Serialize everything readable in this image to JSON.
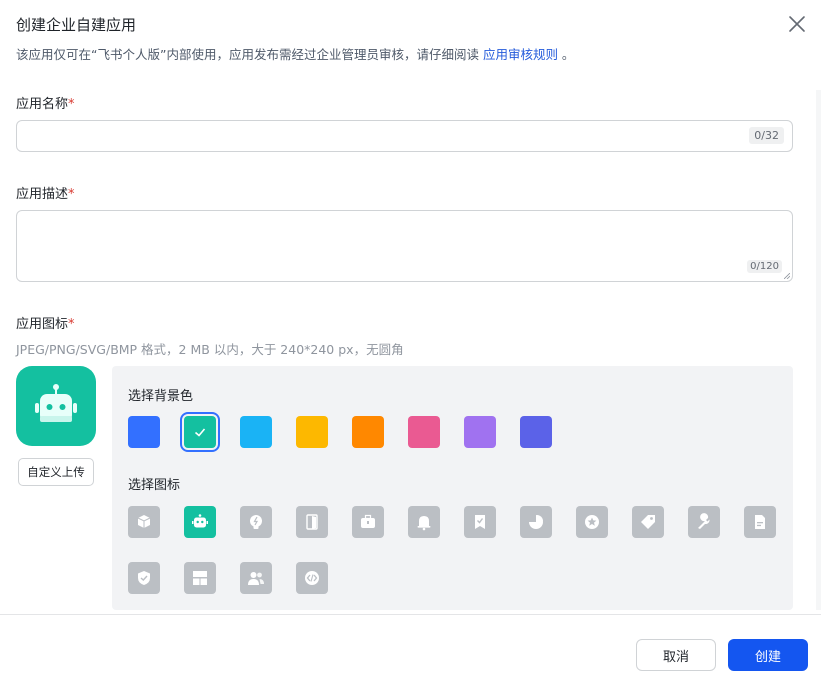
{
  "dialog": {
    "title": "创建企业自建应用",
    "notice_text": "该应用仅可在“飞书个人版”内部使用，应用发布需经过企业管理员审核，请仔细阅读 ",
    "notice_link": "应用审核规则",
    "notice_suffix": " 。"
  },
  "form": {
    "name_label": "应用名称",
    "name_value": "",
    "name_counter": "0/32",
    "desc_label": "应用描述",
    "desc_value": "",
    "desc_counter": "0/120",
    "required_mark": "*",
    "icon_label": "应用图标",
    "icon_hint": "JPEG/PNG/SVG/BMP 格式，2 MB 以内，大于 240*240 px，无圆角",
    "upload_label": "自定义上传"
  },
  "picker": {
    "bg_title": "选择背景色",
    "icon_title": "选择图标",
    "colors": [
      "#3370ff",
      "#14c0a0",
      "#1ab3f5",
      "#fdb800",
      "#ff8800",
      "#ea5a92",
      "#a072f0",
      "#5b62e8"
    ],
    "selected_color_index": 1,
    "icons": [
      "cube-icon",
      "robot-icon",
      "lightbulb-icon",
      "door-icon",
      "briefcase-icon",
      "bell-icon",
      "bookmark-check-icon",
      "pie-chart-icon",
      "star-badge-icon",
      "tag-icon",
      "wrench-icon",
      "document-icon",
      "shield-check-icon",
      "layout-icon",
      "people-icon",
      "code-icon"
    ],
    "selected_icon_index": 1
  },
  "footer": {
    "cancel_label": "取消",
    "create_label": "创建"
  }
}
